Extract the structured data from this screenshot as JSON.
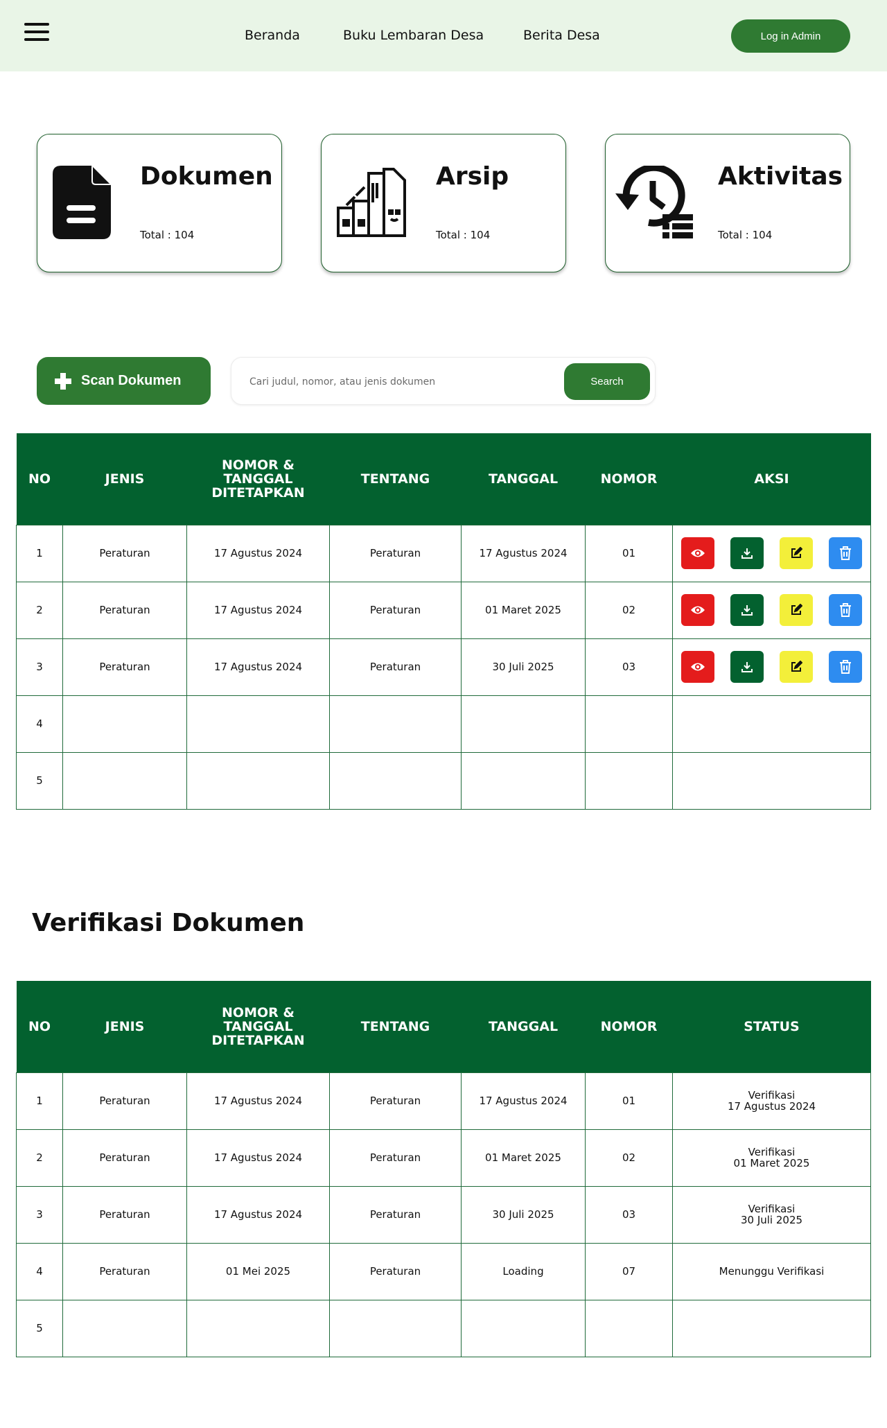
{
  "header": {
    "nav": [
      "Beranda",
      "Buku Lembaran Desa",
      "Berita Desa"
    ],
    "login_label": "Log in Admin"
  },
  "cards": [
    {
      "title": "Dokumen",
      "total": "Total : 104",
      "icon": "document-icon"
    },
    {
      "title": "Arsip",
      "total": "Total : 104",
      "icon": "archive-icon"
    },
    {
      "title": "Aktivitas",
      "total": "Total : 104",
      "icon": "history-icon"
    }
  ],
  "toolbar": {
    "scan_label": "Scan Dokumen",
    "search_placeholder": "Cari judul, nomor, atau jenis dokumen",
    "search_label": "Search"
  },
  "table1": {
    "headers": [
      "NO",
      "JENIS",
      "NOMOR & TANGGAL DITETAPKAN",
      "TENTANG",
      "TANGGAL",
      "NOMOR",
      "AKSI"
    ],
    "rows": [
      {
        "no": "1",
        "jenis": "Peraturan",
        "ditetapkan": "17 Agustus 2024",
        "tentang": "Peraturan",
        "tanggal": "17 Agustus 2024",
        "nomor": "01"
      },
      {
        "no": "2",
        "jenis": "Peraturan",
        "ditetapkan": "17 Agustus 2024",
        "tentang": "Peraturan",
        "tanggal": "01 Maret 2025",
        "nomor": "02"
      },
      {
        "no": "3",
        "jenis": "Peraturan",
        "ditetapkan": "17 Agustus 2024",
        "tentang": "Peraturan",
        "tanggal": "30 Juli 2025",
        "nomor": "03"
      },
      {
        "no": "4"
      },
      {
        "no": "5"
      }
    ]
  },
  "section_title": "Verifikasi Dokumen",
  "table2": {
    "headers": [
      "NO",
      "JENIS",
      "NOMOR & TANGGAL DITETAPKAN",
      "TENTANG",
      "TANGGAL",
      "NOMOR",
      "STATUS"
    ],
    "rows": [
      {
        "no": "1",
        "jenis": "Peraturan",
        "ditetapkan": "17 Agustus 2024",
        "tentang": "Peraturan",
        "tanggal": "17 Agustus 2024",
        "nomor": "01",
        "status_line1": "Verifikasi",
        "status_line2": "17 Agustus 2024"
      },
      {
        "no": "2",
        "jenis": "Peraturan",
        "ditetapkan": "17 Agustus 2024",
        "tentang": "Peraturan",
        "tanggal": "01 Maret 2025",
        "nomor": "02",
        "status_line1": "Verifikasi",
        "status_line2": "01 Maret 2025"
      },
      {
        "no": "3",
        "jenis": "Peraturan",
        "ditetapkan": "17 Agustus 2024",
        "tentang": "Peraturan",
        "tanggal": "30 Juli 2025",
        "nomor": "03",
        "status_line1": "Verifikasi",
        "status_line2": "30 Juli 2025"
      },
      {
        "no": "4",
        "jenis": "Peraturan",
        "ditetapkan": "01 Mei 2025",
        "tentang": "Peraturan",
        "tanggal": "Loading",
        "nomor": "07",
        "status_line1": "Menunggu Verifikasi"
      },
      {
        "no": "5"
      }
    ]
  },
  "colors": {
    "brand_green": "#2f7a32",
    "table_header": "#03612f",
    "header_bg": "#e9f5e7",
    "view": "#e41c1c",
    "download": "#03612f",
    "edit": "#f3ef3a",
    "delete": "#2e8cf0",
    "pending_text": "#2a86d1"
  }
}
